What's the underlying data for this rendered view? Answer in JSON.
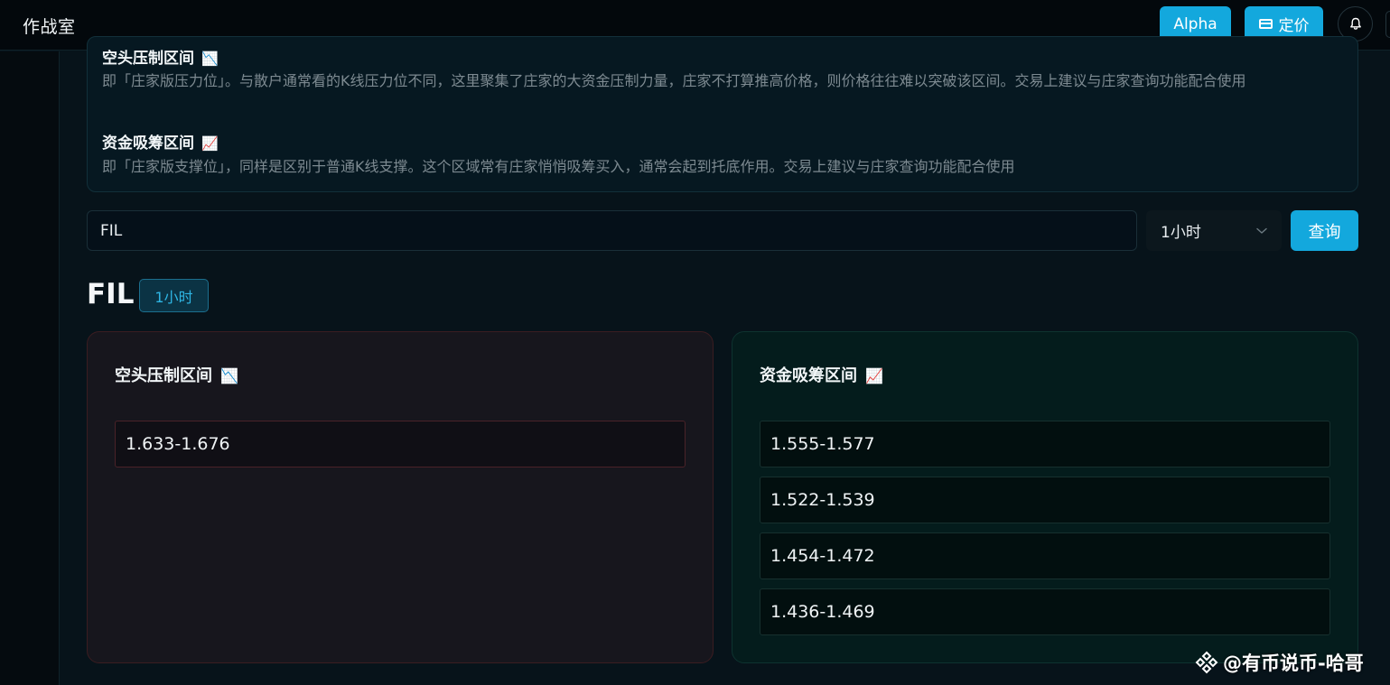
{
  "header": {
    "title": "作战室",
    "alpha_label": "Alpha",
    "pricing_label": "定价"
  },
  "info": {
    "pressure": {
      "title": "空头压制区间",
      "emoji": "📉",
      "description": "即「庄家版压力位」。与散户通常看的K线压力位不同，这里聚集了庄家的大资金压制力量，庄家不打算推高价格，则价格往往难以突破该区间。交易上建议与庄家查询功能配合使用"
    },
    "support": {
      "title": "资金吸筹区间",
      "emoji": "📈",
      "description": "即「庄家版支撑位」，同样是区别于普通K线支撑。这个区域常有庄家悄悄吸筹买入，通常会起到托底作用。交易上建议与庄家查询功能配合使用"
    }
  },
  "search": {
    "value": "FIL",
    "interval": "1小时",
    "button": "查询"
  },
  "result": {
    "symbol": "FIL",
    "interval": "1小时",
    "short_zone": {
      "title": "空头压制区间",
      "emoji": "📉",
      "ranges": [
        "1.633-1.676"
      ]
    },
    "long_zone": {
      "title": "资金吸筹区间",
      "emoji": "📈",
      "ranges": [
        "1.555-1.577",
        "1.522-1.539",
        "1.454-1.472",
        "1.436-1.469"
      ]
    }
  },
  "watermark": {
    "text": "@有币说币-哈哥"
  },
  "colors": {
    "accent": "#13a8dd",
    "background": "#07131a",
    "short_card_bg": "#17161d",
    "long_card_bg": "#041c1c"
  }
}
